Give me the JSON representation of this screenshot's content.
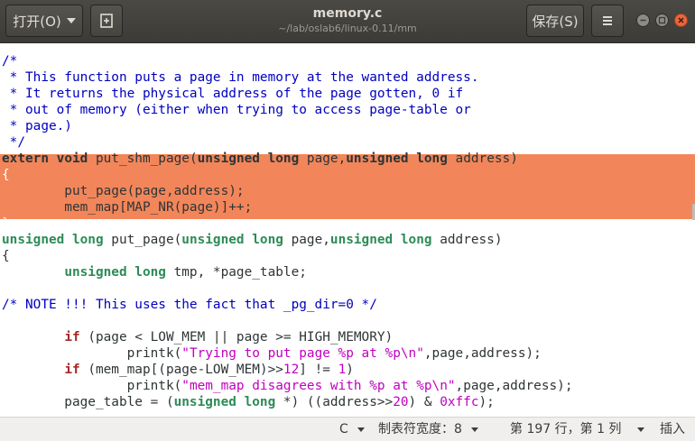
{
  "header": {
    "open_label": "打开(O)",
    "title": "memory.c",
    "subtitle": "~/lab/oslab6/linux-0.11/mm",
    "save_label": "保存(S)"
  },
  "editor": {
    "lines": [
      [
        {
          "t": "/*",
          "c": "comment"
        }
      ],
      [
        {
          "t": " * This function puts a page in memory at the wanted address.",
          "c": "comment"
        }
      ],
      [
        {
          "t": " * It returns the physical address of the page gotten, 0 if",
          "c": "comment"
        }
      ],
      [
        {
          "t": " * out of memory (either when trying to access page-table or",
          "c": "comment"
        }
      ],
      [
        {
          "t": " * page.)",
          "c": "comment"
        }
      ],
      [
        {
          "t": " */",
          "c": "comment"
        }
      ],
      [
        {
          "t": "extern ",
          "c": "hlt-b"
        },
        {
          "t": "void ",
          "c": "hlt-b"
        },
        {
          "t": "put_shm_page(",
          "c": "hlt-w"
        },
        {
          "t": "unsigned long ",
          "c": "hlt-b"
        },
        {
          "t": "page,",
          "c": "hlt-w"
        },
        {
          "t": "unsigned long ",
          "c": "hlt-b"
        },
        {
          "t": "address)",
          "c": "hlt-w"
        }
      ],
      [
        {
          "t": "{",
          "c": "hlt-brace"
        }
      ],
      [
        {
          "t": "        put_page(page,address);",
          "c": "hlt-w"
        }
      ],
      [
        {
          "t": "        mem_map[MAP_NR(page)]++;",
          "c": "hlt-w"
        }
      ],
      [
        {
          "t": "}",
          "c": "hlt-brace"
        }
      ],
      [
        {
          "t": "unsigned long ",
          "c": "type"
        },
        {
          "t": "put_page(",
          "c": ""
        },
        {
          "t": "unsigned long ",
          "c": "type"
        },
        {
          "t": "page,",
          "c": ""
        },
        {
          "t": "unsigned long ",
          "c": "type"
        },
        {
          "t": "address)",
          "c": ""
        }
      ],
      [
        {
          "t": "{",
          "c": ""
        }
      ],
      [
        {
          "t": "        ",
          "c": ""
        },
        {
          "t": "unsigned long ",
          "c": "type"
        },
        {
          "t": "tmp, *page_table;",
          "c": ""
        }
      ],
      [
        {
          "t": "",
          "c": ""
        }
      ],
      [
        {
          "t": "/* NOTE !!! This uses the fact that _pg_dir=0 */",
          "c": "comment"
        }
      ],
      [
        {
          "t": "",
          "c": ""
        }
      ],
      [
        {
          "t": "        ",
          "c": ""
        },
        {
          "t": "if ",
          "c": "kw"
        },
        {
          "t": "(page < LOW_MEM || page >= HIGH_MEMORY)",
          "c": ""
        }
      ],
      [
        {
          "t": "                printk(",
          "c": ""
        },
        {
          "t": "\"Trying to put page %p at %p\\n\"",
          "c": "str"
        },
        {
          "t": ",page,address);",
          "c": ""
        }
      ],
      [
        {
          "t": "        ",
          "c": ""
        },
        {
          "t": "if ",
          "c": "kw"
        },
        {
          "t": "(mem_map[(page-LOW_MEM)>>",
          "c": ""
        },
        {
          "t": "12",
          "c": "num"
        },
        {
          "t": "] != ",
          "c": ""
        },
        {
          "t": "1",
          "c": "num"
        },
        {
          "t": ")",
          "c": ""
        }
      ],
      [
        {
          "t": "                printk(",
          "c": ""
        },
        {
          "t": "\"mem_map disagrees with %p at %p\\n\"",
          "c": "str"
        },
        {
          "t": ",page,address);",
          "c": ""
        }
      ],
      [
        {
          "t": "        page_table = (",
          "c": ""
        },
        {
          "t": "unsigned long ",
          "c": "type"
        },
        {
          "t": "*) ((address>>",
          "c": ""
        },
        {
          "t": "20",
          "c": "num"
        },
        {
          "t": ") & ",
          "c": ""
        },
        {
          "t": "0xffc",
          "c": "num"
        },
        {
          "t": ");",
          "c": ""
        }
      ]
    ]
  },
  "statusbar": {
    "language": "C",
    "tab_width": "制表符宽度：8",
    "position": "第 197 行，第 1 列",
    "mode": "插入"
  }
}
